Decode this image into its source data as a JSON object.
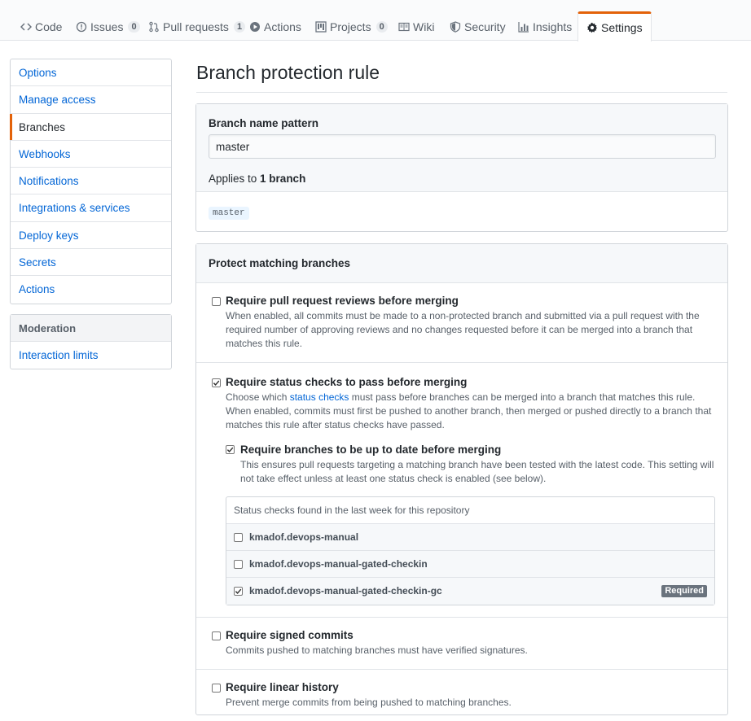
{
  "tabs": [
    {
      "label": "Code",
      "icon": "code-icon",
      "counter": null
    },
    {
      "label": "Issues",
      "icon": "issue-icon",
      "counter": "0"
    },
    {
      "label": "Pull requests",
      "icon": "pull-request-icon",
      "counter": "1"
    },
    {
      "label": "Actions",
      "icon": "play-icon",
      "counter": null
    },
    {
      "label": "Projects",
      "icon": "project-icon",
      "counter": "0"
    },
    {
      "label": "Wiki",
      "icon": "book-icon",
      "counter": null
    },
    {
      "label": "Security",
      "icon": "shield-icon",
      "counter": null
    },
    {
      "label": "Insights",
      "icon": "graph-icon",
      "counter": null
    },
    {
      "label": "Settings",
      "icon": "gear-icon",
      "counter": null
    }
  ],
  "sidebar": {
    "items": [
      {
        "label": "Options"
      },
      {
        "label": "Manage access"
      },
      {
        "label": "Branches"
      },
      {
        "label": "Webhooks"
      },
      {
        "label": "Notifications"
      },
      {
        "label": "Integrations & services"
      },
      {
        "label": "Deploy keys"
      },
      {
        "label": "Secrets"
      },
      {
        "label": "Actions"
      }
    ],
    "moderation_heading": "Moderation",
    "moderation_items": [
      {
        "label": "Interaction limits"
      }
    ]
  },
  "main": {
    "title": "Branch protection rule",
    "pattern_label": "Branch name pattern",
    "pattern_value": "master",
    "applies_prefix": "Applies to ",
    "applies_count": "1 branch",
    "branch_tag": "master",
    "protect_heading": "Protect matching branches",
    "options": {
      "reviews": {
        "title": "Require pull request reviews before merging",
        "desc": "When enabled, all commits must be made to a non-protected branch and submitted via a pull request with the required number of approving reviews and no changes requested before it can be merged into a branch that matches this rule.",
        "checked": false
      },
      "status": {
        "title": "Require status checks to pass before merging",
        "desc_prefix": "Choose which ",
        "desc_link": "status checks",
        "desc_suffix": " must pass before branches can be merged into a branch that matches this rule. When enabled, commits must first be pushed to another branch, then merged or pushed directly to a branch that matches this rule after status checks have passed.",
        "checked": true,
        "uptodate_title": "Require branches to be up to date before merging",
        "uptodate_desc": "This ensures pull requests targeting a matching branch have been tested with the latest code. This setting will not take effect unless at least one status check is enabled (see below).",
        "uptodate_checked": true,
        "checks_heading": "Status checks found in the last week for this repository",
        "checks": [
          {
            "name": "kmadof.devops-manual",
            "checked": false,
            "badge": ""
          },
          {
            "name": "kmadof.devops-manual-gated-checkin",
            "checked": false,
            "badge": ""
          },
          {
            "name": "kmadof.devops-manual-gated-checkin-gc",
            "checked": true,
            "badge": "Required"
          }
        ]
      },
      "signed": {
        "title": "Require signed commits",
        "desc": "Commits pushed to matching branches must have verified signatures.",
        "checked": false
      },
      "linear": {
        "title": "Require linear history",
        "desc": "Prevent merge commits from being pushed to matching branches.",
        "checked": false
      }
    }
  },
  "colors": {
    "accent": "#e36209",
    "link": "#0366d6",
    "badge": "#6a737d"
  }
}
